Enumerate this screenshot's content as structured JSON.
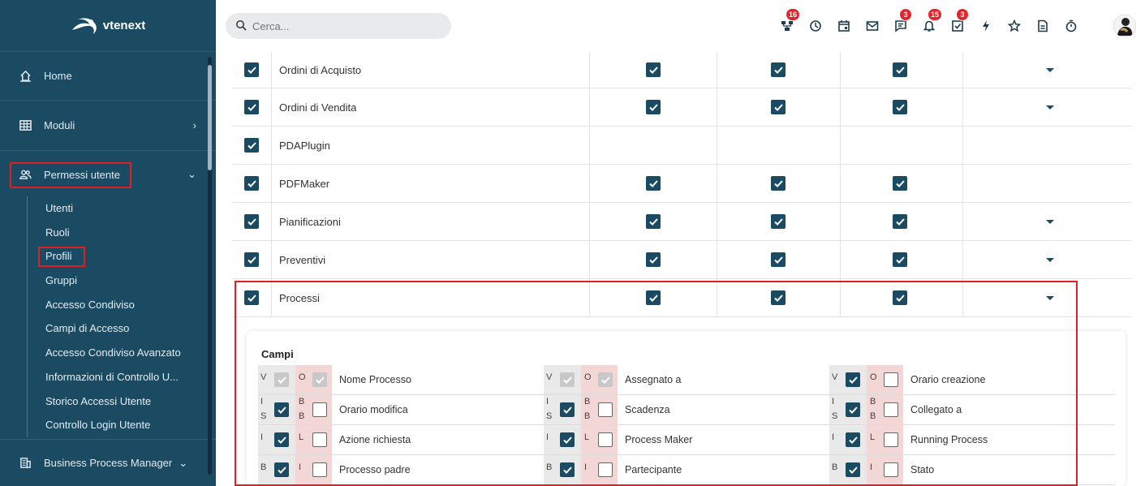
{
  "brand": {
    "name": "vtenext"
  },
  "sidebar": {
    "items": [
      {
        "label": "Home",
        "icon": "home-icon"
      },
      {
        "label": "Moduli",
        "icon": "grid-icon"
      },
      {
        "label": "Permessi utente",
        "icon": "users-icon"
      }
    ],
    "subitems": [
      "Utenti",
      "Ruoli",
      "Profili",
      "Gruppi",
      "Accesso Condiviso",
      "Campi di Accesso",
      "Accesso Condiviso Avanzato",
      "Informazioni di Controllo U...",
      "Storico Accessi Utente",
      "Controllo Login Utente"
    ],
    "active_subitem": "Profili",
    "bottom_item": {
      "label": "Business Process Manager",
      "icon": "building-icon"
    }
  },
  "search": {
    "placeholder": "Cerca..."
  },
  "topbar": {
    "icons": [
      {
        "name": "processes-icon",
        "badge": "16"
      },
      {
        "name": "history-icon",
        "badge": ""
      },
      {
        "name": "calendar-icon",
        "badge": ""
      },
      {
        "name": "mail-icon",
        "badge": ""
      },
      {
        "name": "chat-icon",
        "badge": "3"
      },
      {
        "name": "bell-icon",
        "badge": "15"
      },
      {
        "name": "tasks-icon",
        "badge": "3"
      },
      {
        "name": "lightning-icon",
        "badge": ""
      },
      {
        "name": "star-icon",
        "badge": ""
      },
      {
        "name": "document-icon",
        "badge": ""
      },
      {
        "name": "timer-icon",
        "badge": ""
      }
    ]
  },
  "modules": [
    {
      "name": "Ordini di Acquisto",
      "c1": true,
      "c2": true,
      "c3": true,
      "dropdown": true
    },
    {
      "name": "Ordini di Vendita",
      "c1": true,
      "c2": true,
      "c3": true,
      "dropdown": true
    },
    {
      "name": "PDAPlugin",
      "c1": false,
      "c2": false,
      "c3": false,
      "dropdown": false
    },
    {
      "name": "PDFMaker",
      "c1": true,
      "c2": true,
      "c3": true,
      "dropdown": false
    },
    {
      "name": "Pianificazioni",
      "c1": true,
      "c2": true,
      "c3": true,
      "dropdown": true
    },
    {
      "name": "Preventivi",
      "c1": true,
      "c2": true,
      "c3": true,
      "dropdown": true
    },
    {
      "name": "Processi",
      "c1": true,
      "c2": true,
      "c3": true,
      "dropdown": true
    }
  ],
  "campi": {
    "title": "Campi",
    "rows": [
      {
        "left": [
          "V",
          "",
          "O",
          ""
        ],
        "fields": [
          {
            "name": "Nome Processo",
            "v": "dis",
            "o": "dis"
          },
          {
            "name": "Assegnato a",
            "v": "dis",
            "o": "dis"
          },
          {
            "name": "Orario creazione",
            "v": "on",
            "o": "off"
          }
        ]
      },
      {
        "left": [
          "I S",
          "",
          "B B",
          ""
        ],
        "fields": [
          {
            "name": "Orario modifica",
            "v": "on",
            "o": "off"
          },
          {
            "name": "Scadenza",
            "v": "on",
            "o": "off"
          },
          {
            "name": "Collegato a",
            "v": "on",
            "o": "off"
          }
        ]
      },
      {
        "left": [
          "I",
          "",
          "L",
          ""
        ],
        "fields": [
          {
            "name": "Azione richiesta",
            "v": "on",
            "o": "off"
          },
          {
            "name": "Process Maker",
            "v": "on",
            "o": "off"
          },
          {
            "name": "Running Process",
            "v": "on",
            "o": "off"
          }
        ]
      },
      {
        "left": [
          "B",
          "",
          "I",
          ""
        ],
        "fields": [
          {
            "name": "Processo padre",
            "v": "on",
            "o": "off"
          },
          {
            "name": "Partecipante",
            "v": "on",
            "o": "off"
          },
          {
            "name": "Stato",
            "v": "on",
            "o": "off"
          }
        ]
      }
    ],
    "letters": [
      {
        "v1": "V",
        "v2": "",
        "o1": "O",
        "o2": ""
      },
      {
        "v1": "I",
        "v2": "S",
        "o1": "B",
        "o2": "B"
      },
      {
        "v1": "I",
        "v2": "",
        "o1": "L",
        "o2": ""
      },
      {
        "v1": "B",
        "v2": "",
        "o1": "I",
        "o2": ""
      }
    ]
  },
  "colors": {
    "sidebar": "#1b4b63",
    "accent": "#1b4b63",
    "highlight": "#e02020",
    "badge": "#e4252a"
  }
}
